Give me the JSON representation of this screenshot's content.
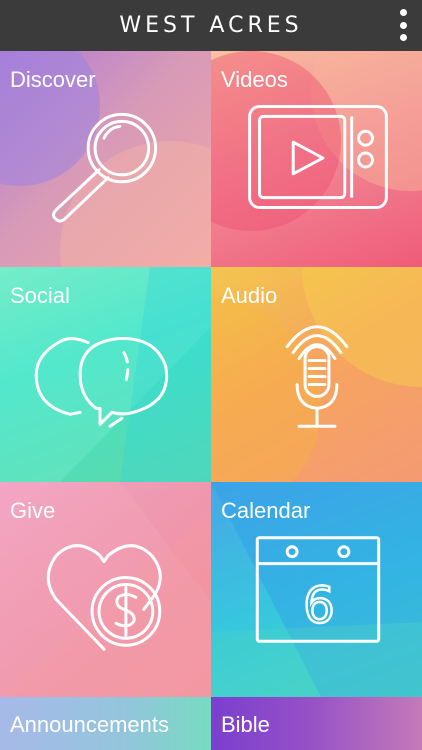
{
  "app": {
    "title": "WEST ACRES",
    "menu_icon": "more-vertical-icon"
  },
  "tiles": [
    {
      "label": "Discover",
      "icon": "magnifier-icon"
    },
    {
      "label": "Videos",
      "icon": "video-player-icon"
    },
    {
      "label": "Social",
      "icon": "speech-bubbles-icon"
    },
    {
      "label": "Audio",
      "icon": "microphone-icon"
    },
    {
      "label": "Give",
      "icon": "heart-dollar-icon"
    },
    {
      "label": "Calendar",
      "icon": "calendar-icon",
      "date": "6"
    },
    {
      "label": "Announcements"
    },
    {
      "label": "Bible"
    }
  ]
}
